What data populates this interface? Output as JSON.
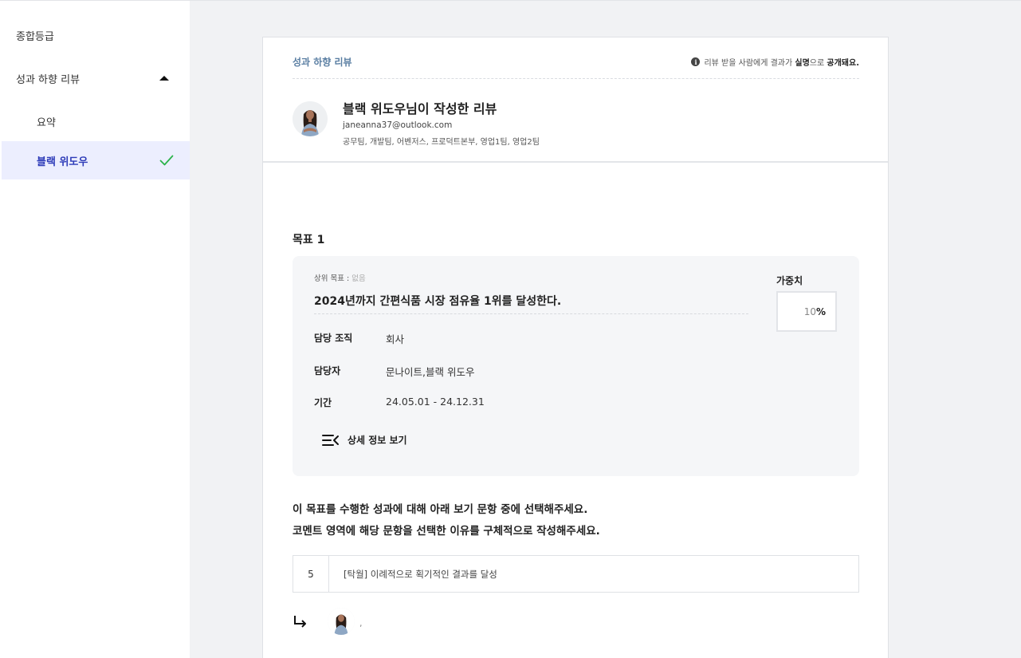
{
  "sidebar": {
    "items": [
      {
        "label": "종합등급"
      },
      {
        "label": "성과 하향 리뷰"
      },
      {
        "label": "요약"
      },
      {
        "label": "블랙 위도우"
      }
    ]
  },
  "card": {
    "section_title": "성과 하향 리뷰",
    "notice": {
      "prefix": "리뷰 받을 사람에게 결과가 ",
      "strong1": "실명",
      "middle": "으로 ",
      "strong2": "공개돼요."
    },
    "reviewer": {
      "name": "블랙 위도우님이 작성한 리뷰",
      "email": "janeanna37@outlook.com",
      "teams": "공무팀, 개발팀, 어벤저스, 프로덕트본부, 영업1팀, 영업2팀"
    }
  },
  "goal": {
    "title": "목표 1",
    "parent_label": "상위 목표 : ",
    "parent_value": "없음",
    "text": "2024년까지 간편식품 시장 점유율 1위를 달성한다.",
    "fields": [
      {
        "label": "담당 조직",
        "value": "회사"
      },
      {
        "label": "담당자",
        "value": "문나이트,블랙 위도우"
      },
      {
        "label": "기간",
        "value": "24.05.01 - 24.12.31"
      }
    ],
    "weight_label": "가중치",
    "weight_value": "10",
    "weight_unit": "%",
    "detail_button": "상세 정보 보기"
  },
  "instructions": [
    "이 목표를 수행한 성과에 대해 아래 보기 문항 중에 선택해주세요.",
    "코멘트 영역에 해당 문항을 선택한 이유를 구체적으로 작성해주세요."
  ],
  "answer": {
    "score": "5",
    "text": "[탁월] 이례적으로 획기적인 결과를 달성"
  },
  "reply": {
    "comment": ","
  },
  "colors": {
    "accent": "#2d3bb8",
    "check": "#2bb34b",
    "section_title": "#5b7fa3"
  }
}
